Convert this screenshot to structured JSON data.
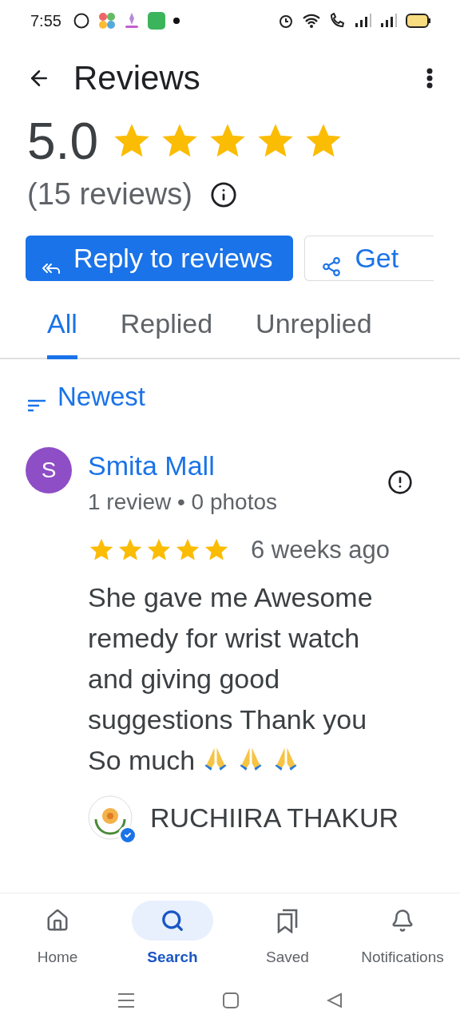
{
  "status_bar": {
    "time": "7:55"
  },
  "header": {
    "title": "Reviews"
  },
  "summary": {
    "rating": "5.0",
    "stars": 5,
    "count": "(15 reviews)"
  },
  "actions": [
    {
      "label": "Reply to reviews",
      "kind": "primary"
    },
    {
      "label": "Get",
      "kind": "outline"
    }
  ],
  "tabs": [
    {
      "label": "All",
      "selected": true
    },
    {
      "label": "Replied",
      "selected": false
    },
    {
      "label": "Unreplied",
      "selected": false
    }
  ],
  "sort": {
    "label": "Newest"
  },
  "reviews": [
    {
      "avatar": "S",
      "color": "#8e4ec6",
      "name": "Smita Mall",
      "meta": "1 review • 0 photos",
      "stars": 5,
      "time": "6 weeks ago",
      "text": "She gave me Awesome remedy for wrist watch and giving good suggestions Thank you So much",
      "reply": {
        "name": "RUCHIIRA THAKUR"
      }
    }
  ],
  "bottom_nav": [
    {
      "label": "Home",
      "selected": false
    },
    {
      "label": "Search",
      "selected": true
    },
    {
      "label": "Saved",
      "selected": false
    },
    {
      "label": "Notifications",
      "selected": false
    }
  ]
}
